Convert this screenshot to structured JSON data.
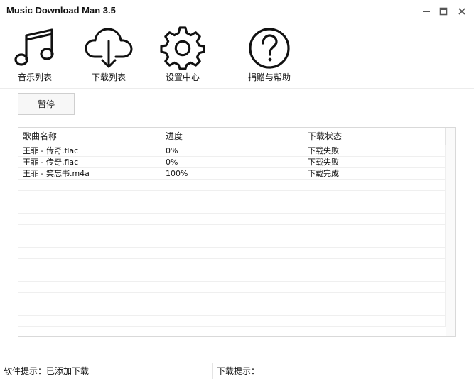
{
  "window": {
    "title": "Music Download Man 3.5",
    "controls": {
      "minimize": "minimize-icon",
      "maximize": "maximize-icon",
      "close": "close-icon"
    }
  },
  "toolbar": {
    "items": [
      {
        "label": "音乐列表",
        "icon": "music-note-icon"
      },
      {
        "label": "下载列表",
        "icon": "cloud-download-icon"
      },
      {
        "label": "设置中心",
        "icon": "gear-icon"
      },
      {
        "label": "捐赠与帮助",
        "icon": "help-icon"
      }
    ]
  },
  "actions": {
    "pause_label": "暂停"
  },
  "download_table": {
    "columns": [
      "歌曲名称",
      "进度",
      "下载状态"
    ],
    "rows": [
      {
        "name": "王菲 - 传奇.flac",
        "progress": "0%",
        "status": "下载失败"
      },
      {
        "name": "王菲 - 传奇.flac",
        "progress": "0%",
        "status": "下载失败"
      },
      {
        "name": "王菲 - 笑忘书.m4a",
        "progress": "100%",
        "status": "下载完成"
      }
    ],
    "empty_rows": 13
  },
  "statusbar": {
    "software_hint": "软件提示：已添加下载",
    "download_hint": "下载提示：",
    "extra": ""
  }
}
